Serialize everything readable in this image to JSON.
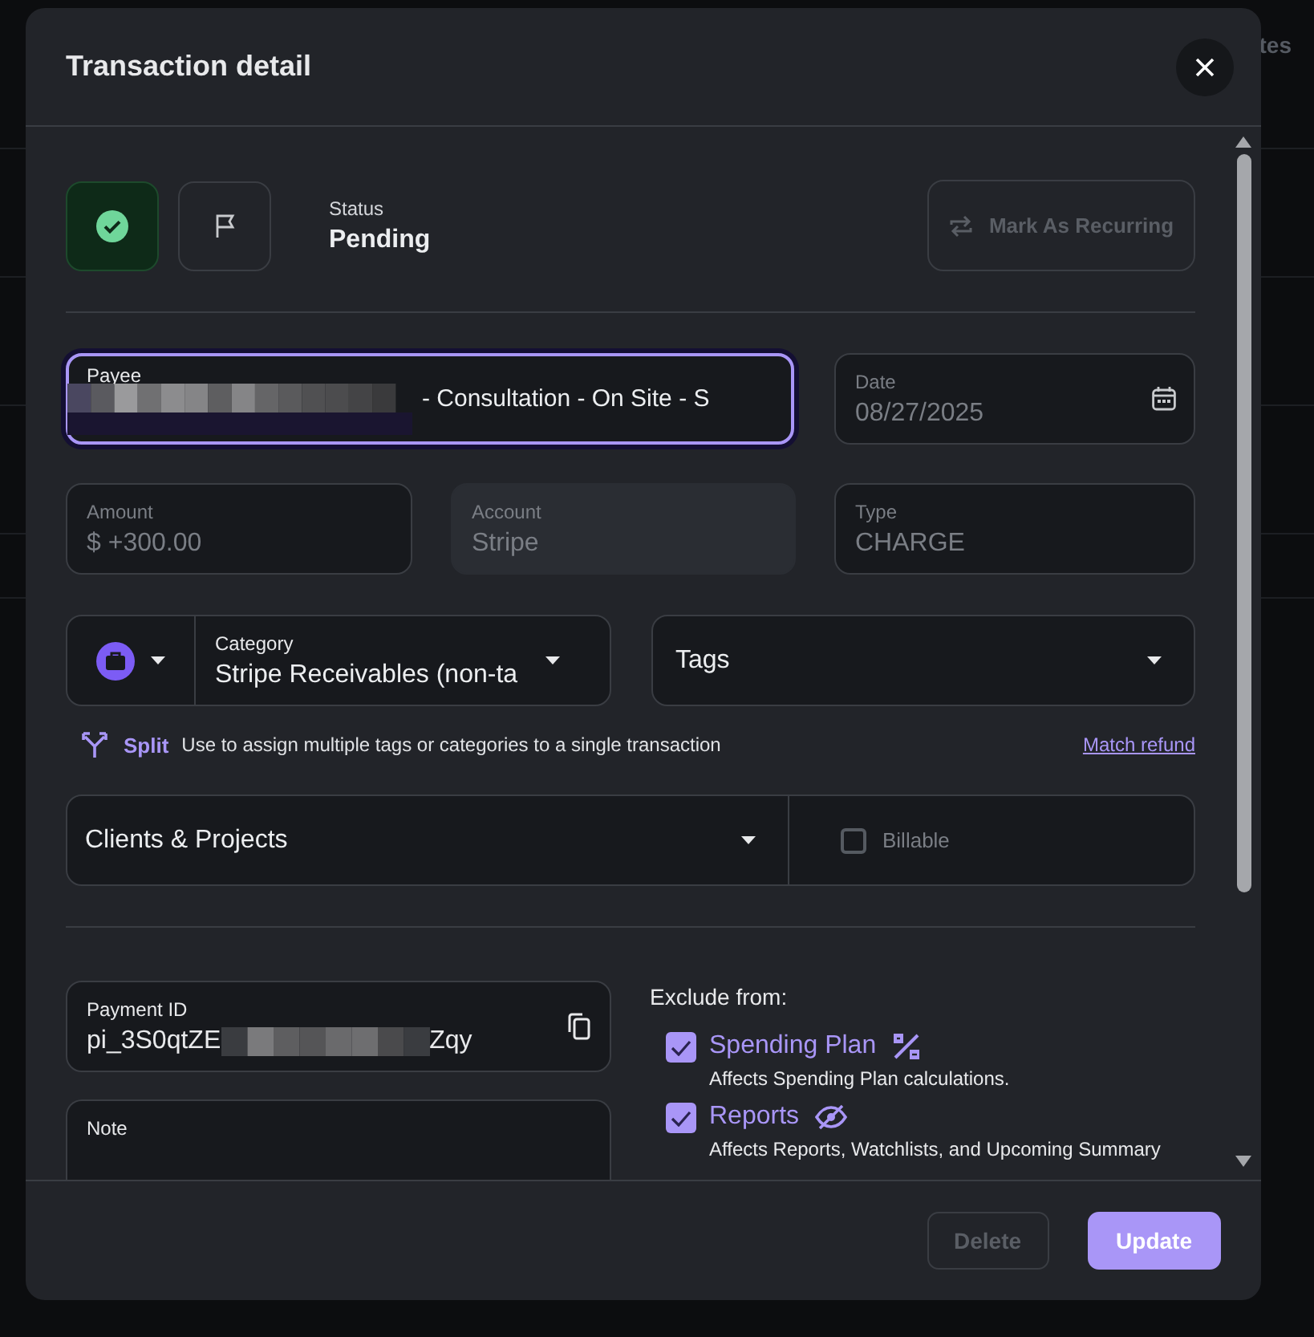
{
  "background": {
    "text": "tes"
  },
  "dialog": {
    "title": "Transaction detail"
  },
  "status_buttons": [
    {
      "kind": "check",
      "selected": true
    },
    {
      "kind": "flag",
      "selected": false
    }
  ],
  "status": {
    "label": "Status",
    "value": "Pending"
  },
  "recurring_button": {
    "label": "Mark As Recurring",
    "disabled": true
  },
  "payee": {
    "label": "Payee",
    "value": "- Consultation - On Site - S",
    "focused": true
  },
  "date": {
    "label": "Date",
    "value": "08/27/2025",
    "disabled": true
  },
  "amount": {
    "label": "Amount",
    "value": "$ +300.00",
    "disabled": true
  },
  "account": {
    "label": "Account",
    "value": "Stripe",
    "disabled": true
  },
  "type": {
    "label": "Type",
    "value": "CHARGE",
    "disabled": true
  },
  "category": {
    "label": "Category",
    "value": "Stripe Receivables (non-ta"
  },
  "tags": {
    "label": "Tags"
  },
  "split": {
    "label": "Split",
    "hint": "Use to assign multiple tags or categories to a single transaction",
    "link": "Match refund"
  },
  "clients": {
    "label": "Clients & Projects"
  },
  "billable": {
    "label": "Billable",
    "checked": false
  },
  "payment_id": {
    "label": "Payment ID",
    "prefix": "pi_3S0qtZE",
    "suffix": "Zqy"
  },
  "note": {
    "label": "Note"
  },
  "exclude": {
    "title": "Exclude from:",
    "options": [
      {
        "kind": "plan",
        "label": "Spending Plan",
        "description": "Affects Spending Plan calculations.",
        "checked": true
      },
      {
        "kind": "reports",
        "label": "Reports",
        "description": "Affects Reports, Watchlists, and Upcoming Summary",
        "checked": true
      }
    ]
  },
  "buttons": [
    {
      "label": "Delete",
      "disabled": true
    },
    {
      "label": "Update",
      "disabled": false
    }
  ]
}
